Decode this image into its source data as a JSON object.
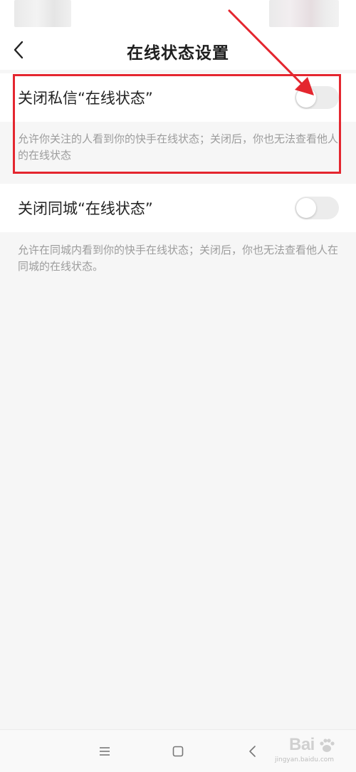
{
  "header": {
    "title": "在线状态设置",
    "back_icon": "chevron-left-icon"
  },
  "settings": [
    {
      "label": "关闭私信“在线状态”",
      "toggle_on": false,
      "description": "允许你关注的人看到你的快手在线状态；关闭后，你也无法查看他人的在线状态"
    },
    {
      "label": "关闭同城“在线状态”",
      "toggle_on": false,
      "description": "允许在同城内看到你的快手在线状态；关闭后，你也无法查看他人在同城的在线状态。"
    }
  ],
  "nav_bar": {
    "icons": [
      "menu-icon",
      "home-square-icon",
      "back-chevron-icon"
    ]
  },
  "annotation": {
    "color": "#e4262f"
  },
  "watermark": {
    "brand": "Bai",
    "url": "jingyan.baidu.com"
  },
  "colors": {
    "background": "#f6f6f6",
    "card": "#ffffff",
    "toggle_off": "#ececec",
    "description_text": "#9c9c9c"
  }
}
